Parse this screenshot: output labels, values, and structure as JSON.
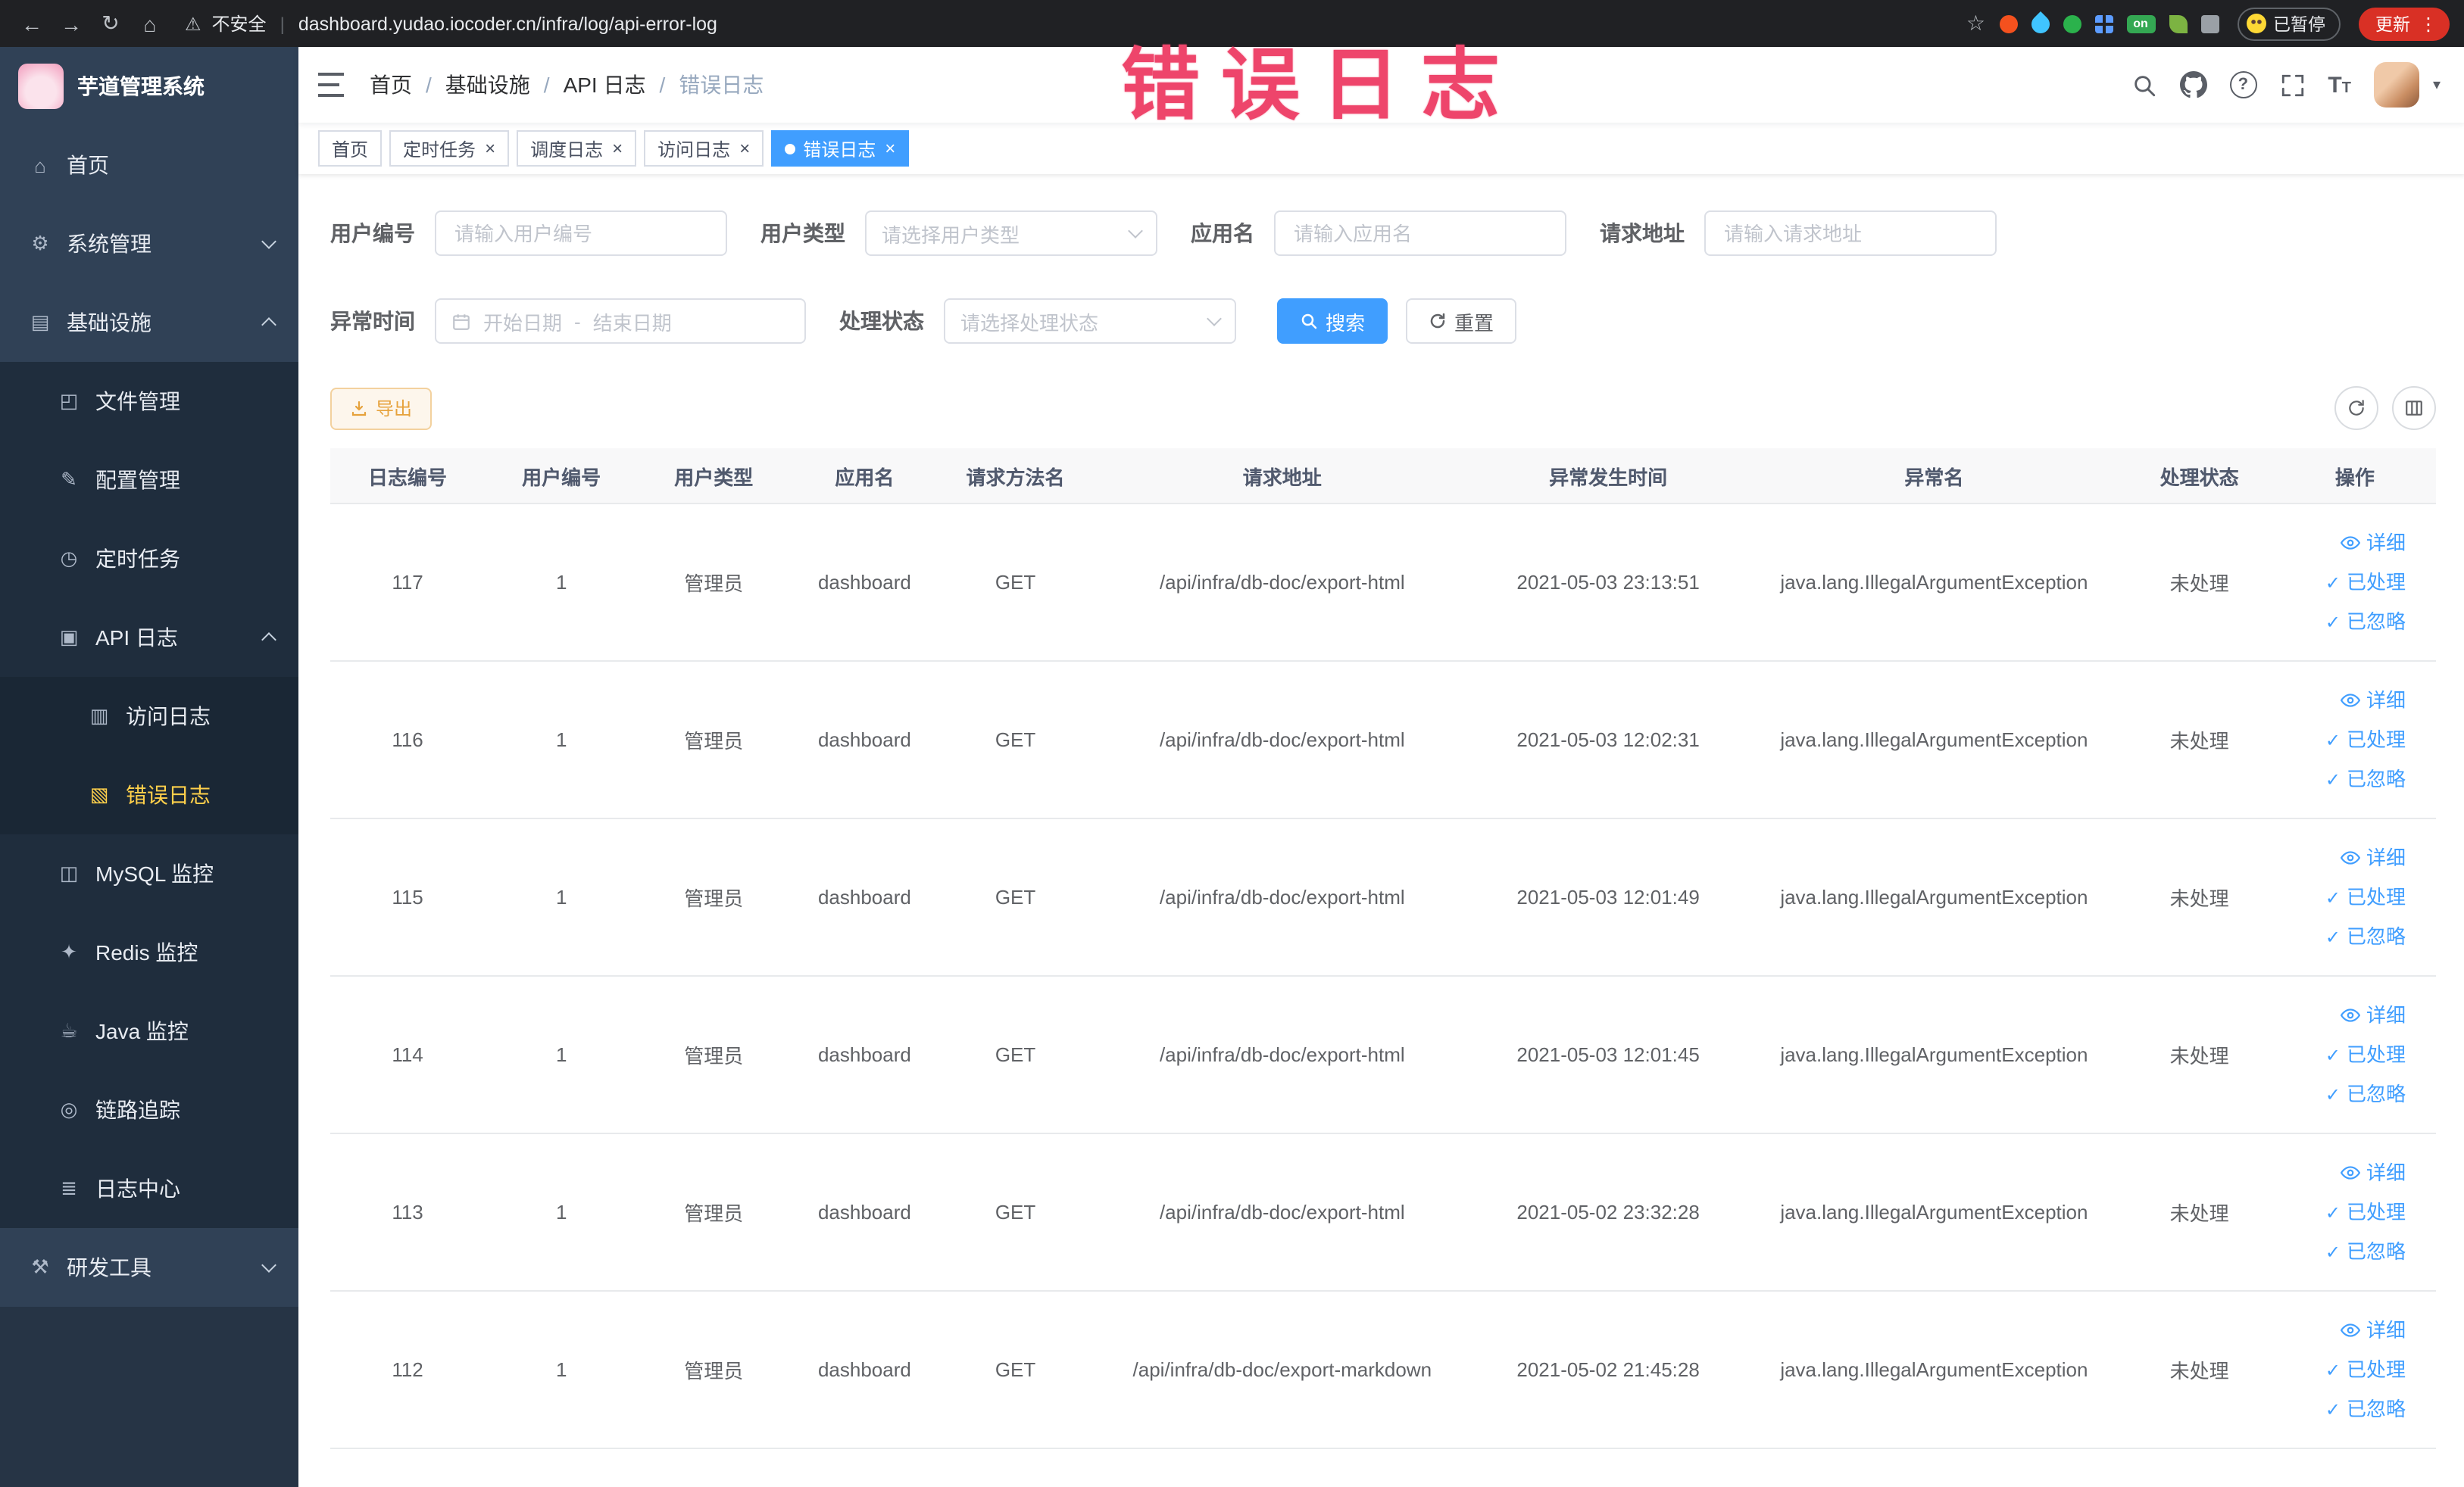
{
  "browser": {
    "security_label": "不安全",
    "url": "dashboard.yudao.iocoder.cn/infra/log/api-error-log",
    "on_badge_label": "on",
    "profile_label": "已暂停",
    "update_label": "更新"
  },
  "annotation": {
    "text": "错误日志",
    "color": "#ee456b"
  },
  "icons": {
    "back": "←",
    "forward": "→",
    "reload": "↻",
    "browser-home": "⌂",
    "warning": "⚠",
    "star": "☆",
    "kebab": "⋮",
    "close": "×",
    "help_glyph": "?",
    "font_glyph": "T",
    "caret_down": "▾",
    "check": "✓",
    "home": "⌂",
    "system-gear": "⚙",
    "infrastructure": "▤",
    "file-manage": "◰",
    "config-manage": "✎",
    "scheduled-task": "◷",
    "api-log": "▣",
    "access-log": "▥",
    "error-log": "▧",
    "mysql-monitor": "◫",
    "redis-monitor": "✦",
    "java-monitor": "☕",
    "trace": "◎",
    "log-center": "≣",
    "dev-tools": "⚒"
  },
  "sidebar": {
    "logo_title": "芋道管理系统",
    "items": [
      {
        "label": "首页",
        "icon": "home",
        "depth": 0
      },
      {
        "label": "系统管理",
        "icon": "system-gear",
        "depth": 0,
        "chevron": "down"
      },
      {
        "label": "基础设施",
        "icon": "infrastructure",
        "depth": 0,
        "chevron": "up"
      },
      {
        "label": "文件管理",
        "icon": "file-manage",
        "depth": 1
      },
      {
        "label": "配置管理",
        "icon": "config-manage",
        "depth": 1
      },
      {
        "label": "定时任务",
        "icon": "scheduled-task",
        "depth": 1
      },
      {
        "label": "API 日志",
        "icon": "api-log",
        "depth": 1,
        "chevron": "up"
      },
      {
        "label": "访问日志",
        "icon": "access-log",
        "depth": 2
      },
      {
        "label": "错误日志",
        "icon": "error-log",
        "depth": 2,
        "active": true
      },
      {
        "label": "MySQL 监控",
        "icon": "mysql-monitor",
        "depth": 1
      },
      {
        "label": "Redis 监控",
        "icon": "redis-monitor",
        "depth": 1
      },
      {
        "label": "Java 监控",
        "icon": "java-monitor",
        "depth": 1
      },
      {
        "label": "链路追踪",
        "icon": "trace",
        "depth": 1
      },
      {
        "label": "日志中心",
        "icon": "log-center",
        "depth": 1
      },
      {
        "label": "研发工具",
        "icon": "dev-tools",
        "depth": 0,
        "chevron": "down"
      }
    ]
  },
  "breadcrumb": [
    "首页",
    "基础设施",
    "API 日志",
    "错误日志"
  ],
  "tabs": [
    {
      "label": "首页",
      "closable": false,
      "active": false
    },
    {
      "label": "定时任务",
      "closable": true,
      "active": false
    },
    {
      "label": "调度日志",
      "closable": true,
      "active": false
    },
    {
      "label": "访问日志",
      "closable": true,
      "active": false
    },
    {
      "label": "错误日志",
      "closable": true,
      "active": true
    }
  ],
  "filters": {
    "user_id": {
      "label": "用户编号",
      "placeholder": "请输入用户编号"
    },
    "user_type": {
      "label": "用户类型",
      "placeholder": "请选择用户类型"
    },
    "app_name": {
      "label": "应用名",
      "placeholder": "请输入应用名"
    },
    "request_url": {
      "label": "请求地址",
      "placeholder": "请输入请求地址"
    },
    "exception_time": {
      "label": "异常时间",
      "start_placeholder": "开始日期",
      "separator": "-",
      "end_placeholder": "结束日期"
    },
    "process_status": {
      "label": "处理状态",
      "placeholder": "请选择处理状态"
    },
    "search_label": "搜索",
    "reset_label": "重置"
  },
  "toolbar": {
    "export_label": "导出"
  },
  "table": {
    "columns": [
      "日志编号",
      "用户编号",
      "用户类型",
      "应用名",
      "请求方法名",
      "请求地址",
      "异常发生时间",
      "异常名",
      "处理状态",
      "操作"
    ],
    "action_labels": {
      "detail": "详细",
      "processed": "已处理",
      "ignore": "已忽略"
    },
    "rows": [
      {
        "log_id": "117",
        "user_id": "1",
        "user_type": "管理员",
        "app_name": "dashboard",
        "method": "GET",
        "request_url": "/api/infra/db-doc/export-html",
        "time": "2021-05-03 23:13:51",
        "exception": "java.lang.IllegalArgumentException",
        "status": "未处理"
      },
      {
        "log_id": "116",
        "user_id": "1",
        "user_type": "管理员",
        "app_name": "dashboard",
        "method": "GET",
        "request_url": "/api/infra/db-doc/export-html",
        "time": "2021-05-03 12:02:31",
        "exception": "java.lang.IllegalArgumentException",
        "status": "未处理"
      },
      {
        "log_id": "115",
        "user_id": "1",
        "user_type": "管理员",
        "app_name": "dashboard",
        "method": "GET",
        "request_url": "/api/infra/db-doc/export-html",
        "time": "2021-05-03 12:01:49",
        "exception": "java.lang.IllegalArgumentException",
        "status": "未处理"
      },
      {
        "log_id": "114",
        "user_id": "1",
        "user_type": "管理员",
        "app_name": "dashboard",
        "method": "GET",
        "request_url": "/api/infra/db-doc/export-html",
        "time": "2021-05-03 12:01:45",
        "exception": "java.lang.IllegalArgumentException",
        "status": "未处理"
      },
      {
        "log_id": "113",
        "user_id": "1",
        "user_type": "管理员",
        "app_name": "dashboard",
        "method": "GET",
        "request_url": "/api/infra/db-doc/export-html",
        "time": "2021-05-02 23:32:28",
        "exception": "java.lang.IllegalArgumentException",
        "status": "未处理"
      },
      {
        "log_id": "112",
        "user_id": "1",
        "user_type": "管理员",
        "app_name": "dashboard",
        "method": "GET",
        "request_url": "/api/infra/db-doc/export-markdown",
        "time": "2021-05-02 21:45:28",
        "exception": "java.lang.IllegalArgumentException",
        "status": "未处理"
      }
    ]
  },
  "colors": {
    "accent": "#409EFF",
    "menu_active_text": "#ffd04b",
    "warning_text": "#e6a23c",
    "annotation": "#ee456b"
  }
}
